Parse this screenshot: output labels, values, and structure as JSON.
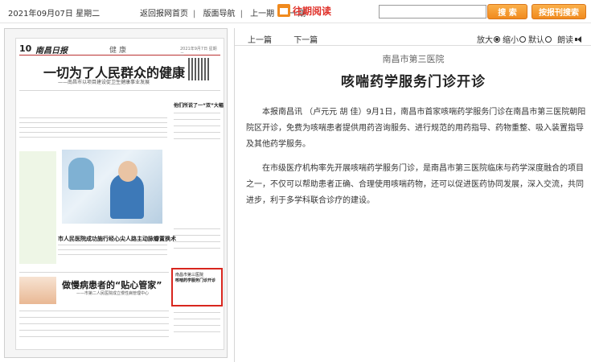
{
  "topbar": {
    "date": "2021年09月07日 星期二",
    "nav": [
      "返回报网首页",
      "版面导航",
      "上一期",
      "下一期"
    ],
    "wangqi": "往期阅读",
    "search_placeholder": "",
    "search_button": "搜 索",
    "adv_search_button": "按报刊搜索"
  },
  "thumbnail": {
    "page_number": "10",
    "paper_name": "南昌日报",
    "section": "健康",
    "date": "2021年9月7日 星期二",
    "main_headline": "一切为了人民群众的健康",
    "main_subhead": "——南昌市以项目建设促卫生健康事业发展",
    "side_headline": "他们所说了一“双”大幅分明",
    "mid_headline": "市人民医院成功施行经心尖人路主动脉瓣置换术",
    "lower_headline": "做慢病患者的“贴心管家”",
    "lower_subhead": "——市第二人民医院成立慢性病管理中心",
    "highlight_box_kicker": "南昌市第三医院",
    "highlight_box_title": "咳喘药学服务门诊开诊"
  },
  "article": {
    "nav_prev": "上一篇",
    "nav_next": "下一篇",
    "font_enlarge": "放大",
    "font_shrink": "缩小",
    "font_default": "默认",
    "read_aloud": "朗读",
    "kicker": "南昌市第三医院",
    "title": "咳喘药学服务门诊开诊",
    "paragraphs": [
      "本报南昌讯 （卢元元 胡 佳）9月1日，南昌市首家咳喘药学服务门诊在南昌市第三医院朝阳院区开诊，免费为咳喘患者提供用药咨询服务、进行规范的用药指导、药物重整、吸入装置指导及其他药学服务。",
      "在市级医疗机构率先开展咳喘药学服务门诊，是南昌市第三医院临床与药学深度融合的项目之一，不仅可以帮助患者正确、合理使用咳喘药物，还可以促进医药协同发展，深入交流，共同进步，利于多学科联合诊疗的建设。"
    ]
  },
  "colors": {
    "accent_orange": "#f08a1e",
    "accent_red": "#d8261e"
  }
}
